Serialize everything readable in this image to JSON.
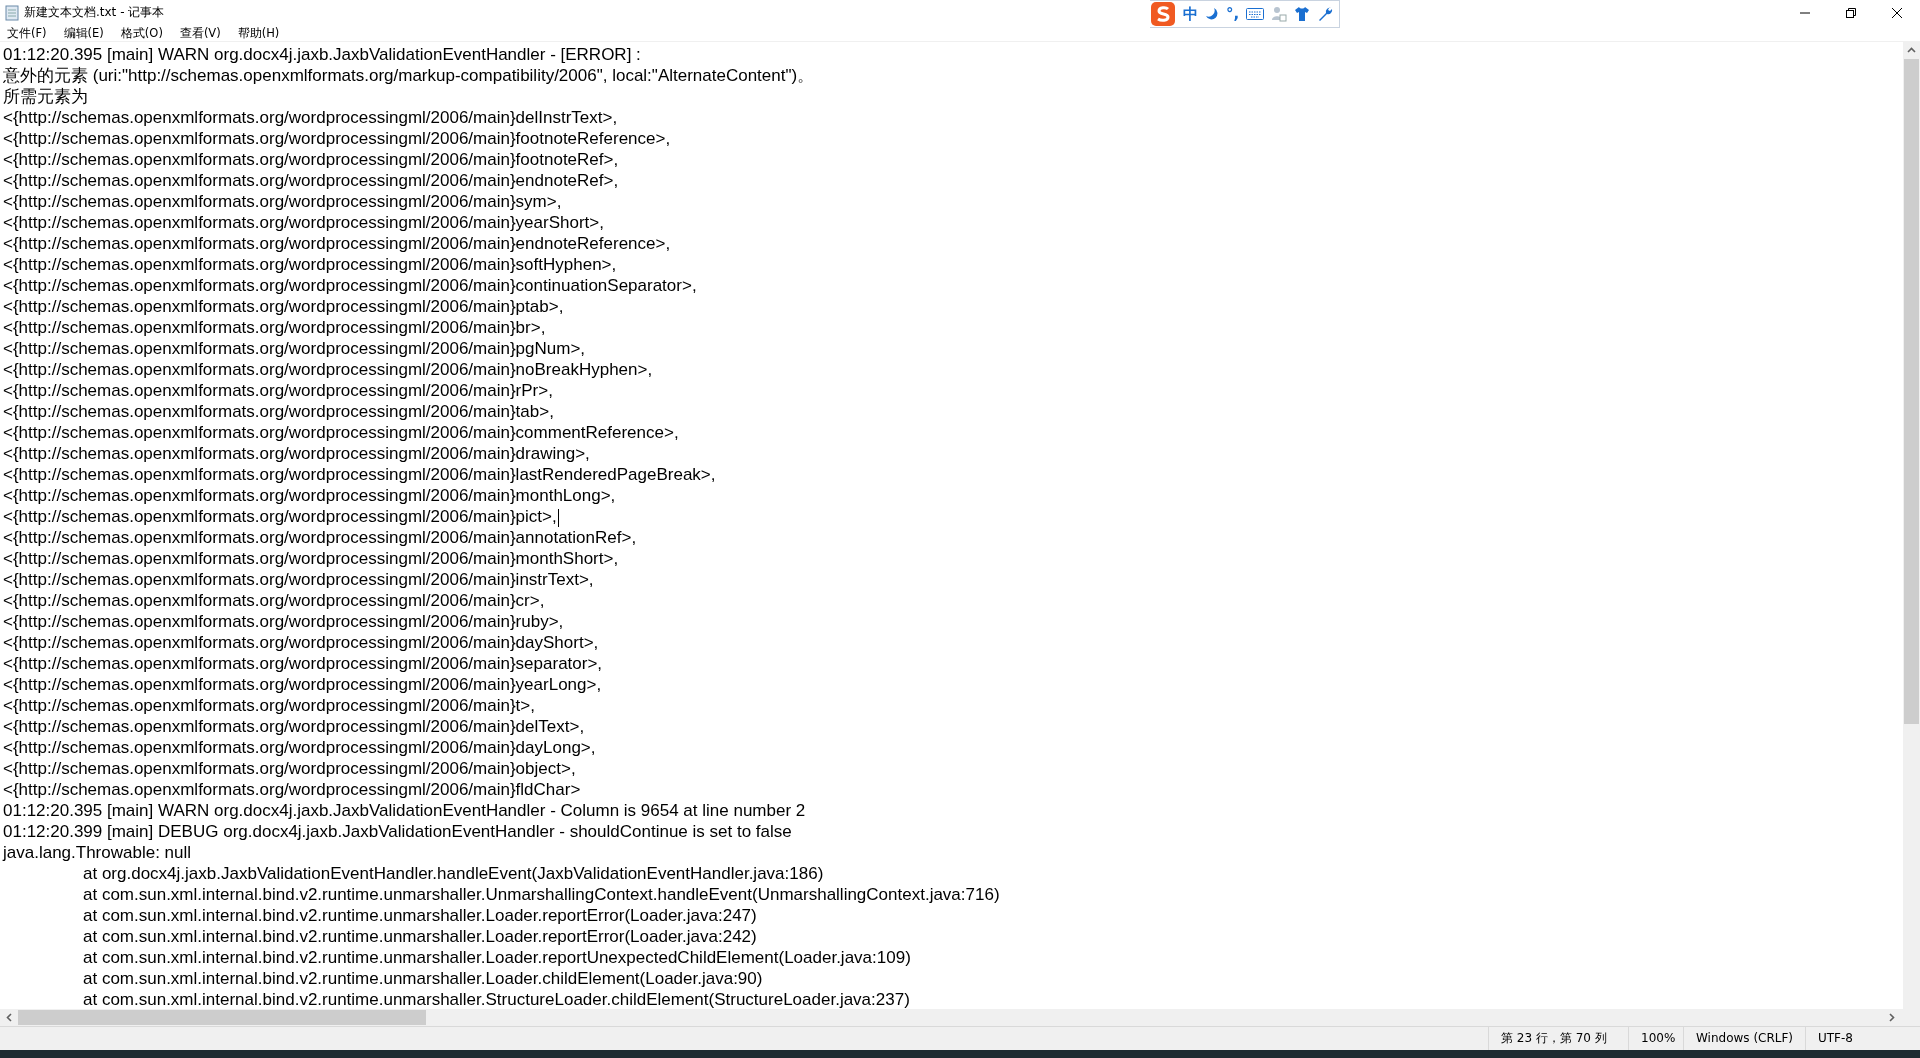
{
  "window": {
    "title": "新建文本文档.txt - 记事本"
  },
  "ime_toolbar": {
    "mode": "中",
    "punctuation": "°,"
  },
  "menu": [
    "文件(F)",
    "编辑(E)",
    "格式(O)",
    "查看(V)",
    "帮助(H)"
  ],
  "lines": [
    {
      "text": "01:12:20.395 [main] WARN org.docx4j.jaxb.JaxbValidationEventHandler - [ERROR] :",
      "caret": false
    },
    {
      "text": "意外的元素 (uri:\"http://schemas.openxmlformats.org/markup-compatibility/2006\", local:\"AlternateContent\")。",
      "caret": false
    },
    {
      "text": "所需元素为",
      "caret": false
    },
    {
      "text": "<{http://schemas.openxmlformats.org/wordprocessingml/2006/main}delInstrText>,",
      "caret": false
    },
    {
      "text": "<{http://schemas.openxmlformats.org/wordprocessingml/2006/main}footnoteReference>,",
      "caret": false
    },
    {
      "text": "<{http://schemas.openxmlformats.org/wordprocessingml/2006/main}footnoteRef>,",
      "caret": false
    },
    {
      "text": "<{http://schemas.openxmlformats.org/wordprocessingml/2006/main}endnoteRef>,",
      "caret": false
    },
    {
      "text": "<{http://schemas.openxmlformats.org/wordprocessingml/2006/main}sym>,",
      "caret": false
    },
    {
      "text": "<{http://schemas.openxmlformats.org/wordprocessingml/2006/main}yearShort>,",
      "caret": false
    },
    {
      "text": "<{http://schemas.openxmlformats.org/wordprocessingml/2006/main}endnoteReference>,",
      "caret": false
    },
    {
      "text": "<{http://schemas.openxmlformats.org/wordprocessingml/2006/main}softHyphen>,",
      "caret": false
    },
    {
      "text": "<{http://schemas.openxmlformats.org/wordprocessingml/2006/main}continuationSeparator>,",
      "caret": false
    },
    {
      "text": "<{http://schemas.openxmlformats.org/wordprocessingml/2006/main}ptab>,",
      "caret": false
    },
    {
      "text": "<{http://schemas.openxmlformats.org/wordprocessingml/2006/main}br>,",
      "caret": false
    },
    {
      "text": "<{http://schemas.openxmlformats.org/wordprocessingml/2006/main}pgNum>,",
      "caret": false
    },
    {
      "text": "<{http://schemas.openxmlformats.org/wordprocessingml/2006/main}noBreakHyphen>,",
      "caret": false
    },
    {
      "text": "<{http://schemas.openxmlformats.org/wordprocessingml/2006/main}rPr>,",
      "caret": false
    },
    {
      "text": "<{http://schemas.openxmlformats.org/wordprocessingml/2006/main}tab>,",
      "caret": false
    },
    {
      "text": "<{http://schemas.openxmlformats.org/wordprocessingml/2006/main}commentReference>,",
      "caret": false
    },
    {
      "text": "<{http://schemas.openxmlformats.org/wordprocessingml/2006/main}drawing>,",
      "caret": false
    },
    {
      "text": "<{http://schemas.openxmlformats.org/wordprocessingml/2006/main}lastRenderedPageBreak>,",
      "caret": false
    },
    {
      "text": "<{http://schemas.openxmlformats.org/wordprocessingml/2006/main}monthLong>,",
      "caret": false
    },
    {
      "text": "<{http://schemas.openxmlformats.org/wordprocessingml/2006/main}pict>,",
      "caret": true
    },
    {
      "text": "<{http://schemas.openxmlformats.org/wordprocessingml/2006/main}annotationRef>,",
      "caret": false
    },
    {
      "text": "<{http://schemas.openxmlformats.org/wordprocessingml/2006/main}monthShort>,",
      "caret": false
    },
    {
      "text": "<{http://schemas.openxmlformats.org/wordprocessingml/2006/main}instrText>,",
      "caret": false
    },
    {
      "text": "<{http://schemas.openxmlformats.org/wordprocessingml/2006/main}cr>,",
      "caret": false
    },
    {
      "text": "<{http://schemas.openxmlformats.org/wordprocessingml/2006/main}ruby>,",
      "caret": false
    },
    {
      "text": "<{http://schemas.openxmlformats.org/wordprocessingml/2006/main}dayShort>,",
      "caret": false
    },
    {
      "text": "<{http://schemas.openxmlformats.org/wordprocessingml/2006/main}separator>,",
      "caret": false
    },
    {
      "text": "<{http://schemas.openxmlformats.org/wordprocessingml/2006/main}yearLong>,",
      "caret": false
    },
    {
      "text": "<{http://schemas.openxmlformats.org/wordprocessingml/2006/main}t>,",
      "caret": false
    },
    {
      "text": "<{http://schemas.openxmlformats.org/wordprocessingml/2006/main}delText>,",
      "caret": false
    },
    {
      "text": "<{http://schemas.openxmlformats.org/wordprocessingml/2006/main}dayLong>,",
      "caret": false
    },
    {
      "text": "<{http://schemas.openxmlformats.org/wordprocessingml/2006/main}object>,",
      "caret": false
    },
    {
      "text": "<{http://schemas.openxmlformats.org/wordprocessingml/2006/main}fldChar>",
      "caret": false
    },
    {
      "text": "01:12:20.395 [main] WARN org.docx4j.jaxb.JaxbValidationEventHandler - Column is 9654 at line number 2",
      "caret": false
    },
    {
      "text": "01:12:20.399 [main] DEBUG org.docx4j.jaxb.JaxbValidationEventHandler - shouldContinue is set to false",
      "caret": false
    },
    {
      "text": "java.lang.Throwable: null",
      "caret": false
    },
    {
      "text": "\tat org.docx4j.jaxb.JaxbValidationEventHandler.handleEvent(JaxbValidationEventHandler.java:186)",
      "caret": false
    },
    {
      "text": "\tat com.sun.xml.internal.bind.v2.runtime.unmarshaller.UnmarshallingContext.handleEvent(UnmarshallingContext.java:716)",
      "caret": false
    },
    {
      "text": "\tat com.sun.xml.internal.bind.v2.runtime.unmarshaller.Loader.reportError(Loader.java:247)",
      "caret": false
    },
    {
      "text": "\tat com.sun.xml.internal.bind.v2.runtime.unmarshaller.Loader.reportError(Loader.java:242)",
      "caret": false
    },
    {
      "text": "\tat com.sun.xml.internal.bind.v2.runtime.unmarshaller.Loader.reportUnexpectedChildElement(Loader.java:109)",
      "caret": false
    },
    {
      "text": "\tat com.sun.xml.internal.bind.v2.runtime.unmarshaller.Loader.childElement(Loader.java:90)",
      "caret": false
    },
    {
      "text": "\tat com.sun.xml.internal.bind.v2.runtime.unmarshaller.StructureLoader.childElement(StructureLoader.java:237)",
      "caret": false
    }
  ],
  "status_bar": {
    "position": "第 23 行，第 70 列",
    "zoom": "100%",
    "line_ending": "Windows (CRLF)",
    "encoding": "UTF-8"
  }
}
